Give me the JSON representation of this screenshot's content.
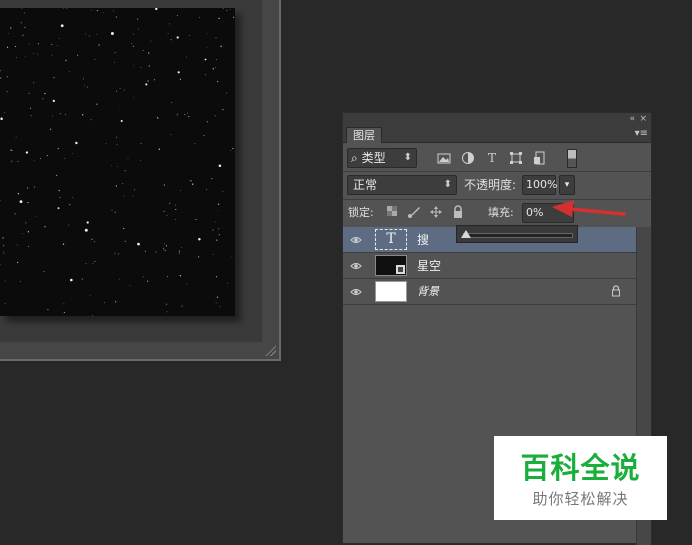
{
  "panel": {
    "topbar": {
      "collapse_icon": "«",
      "close_icon": "×"
    },
    "tab_label": "图层",
    "menu_icon": "▾≡",
    "filter": {
      "search_glyph": "⌕",
      "kind_label": "类型",
      "kind_caret": "⬍",
      "icons": [
        "image-filter-icon",
        "adjustment-filter-icon",
        "type-filter-icon",
        "shape-filter-icon",
        "smart-object-filter-icon"
      ],
      "type_glyph": "T"
    },
    "blend": {
      "mode": "正常",
      "mode_caret": "⬍",
      "opacity_label": "不透明度:",
      "opacity_value": "100%",
      "opacity_arrow": "▾"
    },
    "lock": {
      "label": "锁定:",
      "fill_label": "填充:",
      "fill_value": "0%",
      "fill_slider_value": 0
    },
    "layers": [
      {
        "name": "搜",
        "type": "text",
        "type_glyph": "T",
        "selected": true,
        "visible": true
      },
      {
        "name": "星空",
        "type": "smart",
        "selected": false,
        "visible": true
      },
      {
        "name": "背景",
        "type": "background",
        "selected": false,
        "visible": true,
        "locked": true
      }
    ]
  },
  "colors": {
    "selected_row": "#5d6c82",
    "panel_bg": "#535353",
    "annotation_arrow": "#d62f2f",
    "watermark_green": "#1aae3a"
  },
  "watermark": {
    "title": "百科全说",
    "subtitle": "助你轻松解决"
  }
}
